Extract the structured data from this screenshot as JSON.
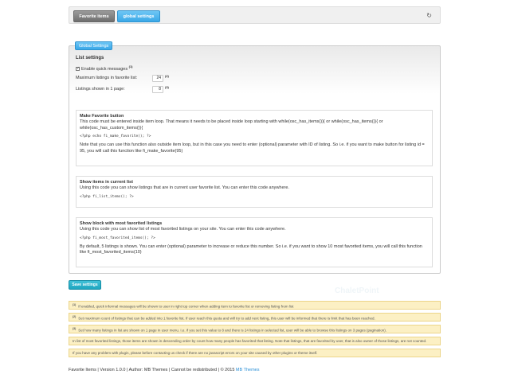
{
  "tabs": [
    {
      "label": "Favorite items"
    },
    {
      "label": "global settings"
    }
  ],
  "panel": {
    "legend": "Global Settings"
  },
  "list_settings": {
    "heading": "List settings",
    "quick_messages_label": "Enable quick messages",
    "quick_messages_note": "(1)",
    "max_listings_label": "Maximum listings in favorite list:",
    "max_listings_value": "24",
    "max_listings_note": "(2)",
    "per_page_label": "Listings shown in 1 page:",
    "per_page_value": "8",
    "per_page_note": "(3)"
  },
  "cards": [
    {
      "title": "Make Favorite button",
      "text": "This code must be entered inside item loop. That means it needs to be placed inside loop starting with while(osc_has_items()){ or while(osc_has_items()){ or while(osc_has_custom_items()){",
      "code": "<?php echo fi_make_favorite(); ?>",
      "text2": "Note that you can use this function also outside item loop, but in this case you need to enter (optional) parameter with ID of listing. So i.e. if you want to make button for listing id = 95, you will call this function like fi_make_favorite(95)"
    },
    {
      "title": "Show items in current list",
      "text": "Using this code you can show listings that are in current user favorite list. You can enter this code anywhere.",
      "code": "<?php fi_list_items(); ?>"
    },
    {
      "title": "Show block with most favorited listings",
      "text": "Using this code you can show list of most favorited listings on your site. You can enter this code anywhere.",
      "code": "<?php fi_most_favorited_items(); ?>",
      "text2": "By default, 5 listings is shown. You can enter (optional) parameter to increase or reduce this number. So i.e. if you want to show 10 most favorited items, you will call this function like fi_most_favorited_items(10)"
    }
  ],
  "save_button": "Save settings",
  "notes": [
    {
      "mark": "(1)",
      "text": "If enabled, quick informal messages will be shown to user in right top corner when adding item to favorite list or removing listing from list"
    },
    {
      "mark": "(2)",
      "text": "Set maximum count of listings that can be added into 1 favorite list. If user reach this quota and will try to add next listing, this user will be informed that there is limit that has been reached."
    },
    {
      "mark": "(3)",
      "text": "Set how many listings in list are shown on 1 page in user menu. I.e. if you set this value to 8 and there is 24 listings in selected list, user will be able to browse this listings on 3 pages (pagination)."
    },
    {
      "mark": "",
      "text": "In list of most favorited listings, those items are shown in descending order by count how many people has favorited that listing. Note that listings, that are favorited by user, that is also owner of those listings, are not counted."
    },
    {
      "mark": "",
      "text": "If you have any problem with plugin, please before contacting us check if there are no javascript errors on your site caused by other plugins or theme itself."
    }
  ],
  "footer": {
    "text": "Favorite Items | Version 1.0.0 | Author: MB Themes | Cannot be redistributed | © 2015",
    "link": "MB Themes"
  },
  "icons": {
    "refresh": "refresh-icon"
  },
  "colors": {
    "accent": "#3aa8e8",
    "save": "#1ea5bf",
    "note_bg": "#fcf0c4"
  }
}
